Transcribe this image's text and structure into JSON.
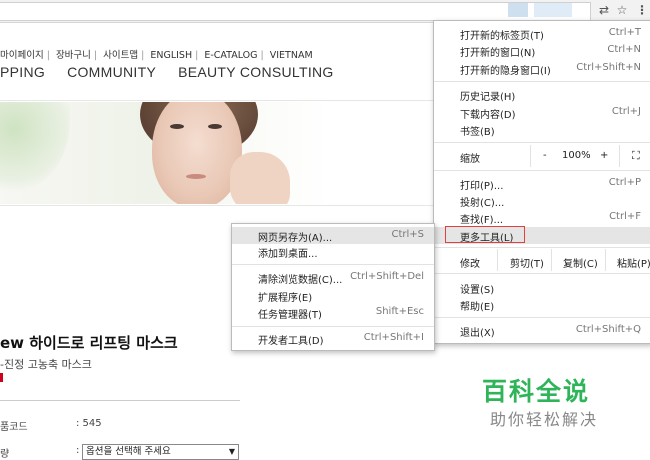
{
  "toolbar": {
    "translate_icon": "translate-icon",
    "star_icon": "star-icon",
    "menu_icon": "more-vert-icon"
  },
  "site": {
    "util_links": [
      "마이페이지",
      "장바구니",
      "사이트맵",
      "ENGLISH",
      "E-CATALOG",
      "VIETNAM"
    ],
    "nav": [
      "PPING",
      "COMMUNITY",
      "BEAUTY CONSULTING"
    ],
    "product": {
      "title": "ew 하이드로 리프팅 마스크",
      "subtitle": "-진정 고농축 마스크",
      "code_label": "품코드",
      "code_value": ": 545",
      "option_label": "량",
      "option_colon": ":",
      "option_placeholder": "옵션을 선택해 주세요",
      "option_arrow": "▼"
    }
  },
  "chrome_menu": {
    "group1": [
      {
        "label": "打开新的标签页(T)",
        "shortcut": "Ctrl+T"
      },
      {
        "label": "打开新的窗口(N)",
        "shortcut": "Ctrl+N"
      },
      {
        "label": "打开新的隐身窗口(I)",
        "shortcut": "Ctrl+Shift+N"
      }
    ],
    "group2": [
      {
        "label": "历史记录(H)",
        "shortcut": ""
      },
      {
        "label": "下载内容(D)",
        "shortcut": "Ctrl+J"
      },
      {
        "label": "书签(B)",
        "shortcut": ""
      }
    ],
    "zoom": {
      "label": "缩放",
      "minus": "-",
      "value": "100%",
      "plus": "+",
      "fullscreen_icon": "fullscreen-icon"
    },
    "group3": [
      {
        "label": "打印(P)...",
        "shortcut": "Ctrl+P"
      },
      {
        "label": "投射(C)...",
        "shortcut": ""
      },
      {
        "label": "查找(F)...",
        "shortcut": "Ctrl+F"
      },
      {
        "label": "更多工具(L)",
        "shortcut": ""
      }
    ],
    "edit": {
      "label": "修改",
      "cut": "剪切(T)",
      "copy": "复制(C)",
      "paste": "粘贴(P)"
    },
    "group4": [
      {
        "label": "设置(S)",
        "shortcut": ""
      },
      {
        "label": "帮助(E)",
        "shortcut": ""
      }
    ],
    "exit": {
      "label": "退出(X)",
      "shortcut": "Ctrl+Shift+Q"
    }
  },
  "submenu": {
    "group1": [
      {
        "label": "网页另存为(A)...",
        "shortcut": "Ctrl+S"
      },
      {
        "label": "添加到桌面...",
        "shortcut": ""
      }
    ],
    "group2": [
      {
        "label": "清除浏览数据(C)...",
        "shortcut": "Ctrl+Shift+Del"
      },
      {
        "label": "扩展程序(E)",
        "shortcut": ""
      },
      {
        "label": "任务管理器(T)",
        "shortcut": "Shift+Esc"
      }
    ],
    "group3": [
      {
        "label": "开发者工具(D)",
        "shortcut": "Ctrl+Shift+I"
      }
    ]
  },
  "watermark": {
    "brand": "百科全说",
    "slogan": "助你轻松解决"
  }
}
